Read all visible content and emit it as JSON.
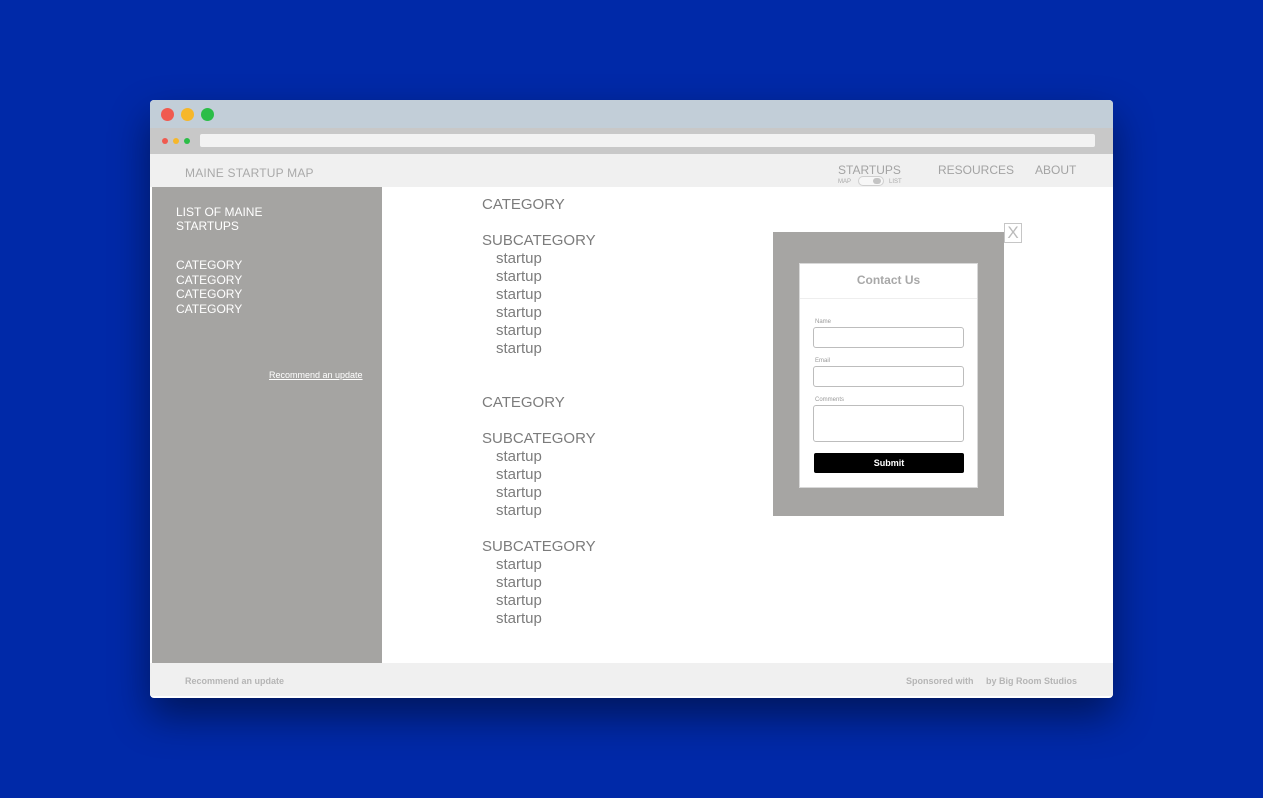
{
  "header": {
    "logo": "MAINE STARTUP MAP",
    "nav": {
      "startups": "STARTUPS",
      "resources": "RESOURCES",
      "about": "ABOUT"
    },
    "toggle": {
      "left_label": "MAP",
      "right_label": "LIST",
      "selected": "LIST"
    }
  },
  "sidebar": {
    "title": "LIST OF MAINE STARTUPS",
    "categories": [
      "CATEGORY",
      "CATEGORY",
      "CATEGORY",
      "CATEGORY"
    ],
    "recommend_link": "Recommend an update"
  },
  "content": {
    "groups": [
      {
        "category": "CATEGORY",
        "subcategories": [
          {
            "title": "SUBCATEGORY",
            "startups": [
              "startup",
              "startup",
              "startup",
              "startup",
              "startup",
              "startup"
            ]
          }
        ]
      },
      {
        "category": "CATEGORY",
        "subcategories": [
          {
            "title": "SUBCATEGORY",
            "startups": [
              "startup",
              "startup",
              "startup",
              "startup"
            ]
          },
          {
            "title": "SUBCATEGORY",
            "startups": [
              "startup",
              "startup",
              "startup",
              "startup"
            ]
          }
        ]
      }
    ]
  },
  "modal": {
    "close_label": "X",
    "title": "Contact Us",
    "fields": [
      {
        "label": "Name",
        "value": ""
      },
      {
        "label": "Email",
        "value": ""
      },
      {
        "label": "Comments",
        "value": ""
      }
    ],
    "submit_label": "Submit"
  },
  "footer": {
    "recommend": "Recommend an update",
    "sponsored": "Sponsored with",
    "by": "by Big Room Studios"
  },
  "icons": {
    "window_controls": [
      "close-dot",
      "minimize-dot",
      "zoom-dot"
    ],
    "colors": {
      "background": "#0029a8",
      "sidebar": "#a5a4a2",
      "overlay": "#a6a5a3",
      "button": "#000000"
    }
  }
}
